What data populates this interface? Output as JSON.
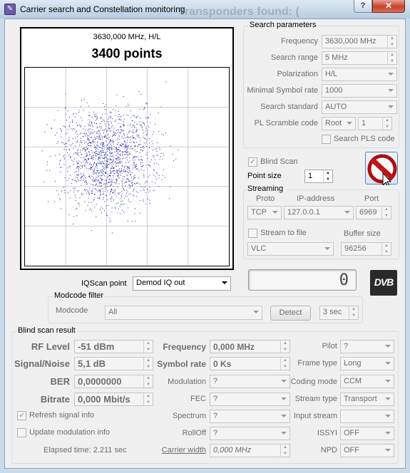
{
  "window": {
    "title": "Carrier search and Constellation monitoring",
    "background_title": "Transponders found: (",
    "help": "?",
    "close": "✕"
  },
  "plot": {
    "frequency_line": "3630,000 MHz, H/L",
    "points_line": "3400 points",
    "dot_color": "#1a1aa8"
  },
  "search": {
    "title": "Search parameters",
    "frequency_label": "Frequency",
    "frequency_value": "3630,000 MHz",
    "range_label": "Search range",
    "range_value": "5 MHz",
    "polarization_label": "Polarization",
    "polarization_value": "H/L",
    "symbolrate_label": "Minimal Symbol rate",
    "symbolrate_value": "1000",
    "standard_label": "Search standard",
    "standard_value": "AUTO",
    "pls_label": "PL Scramble code",
    "pls_mode": "Root",
    "pls_value": "1",
    "search_pls_label": "Search PLS code"
  },
  "blind_scan_label": "Blind Scan",
  "point_size_label": "Point size",
  "point_size_value": "1",
  "streaming": {
    "title": "Streaming",
    "proto_label": "Proto",
    "ip_label": "IP-address",
    "port_label": "Port",
    "proto_value": "TCP",
    "ip_value": "127.0.0.1",
    "port_value": "6969",
    "stream_file_label": "Stream to file",
    "buffer_label": "Buffer size",
    "player_value": "VLC",
    "buffer_value": "96256"
  },
  "iqscan": {
    "label": "IQScan point",
    "value": "Demod IQ out"
  },
  "counter_value": "0",
  "dvb_logo": "DVB",
  "modcode": {
    "title": "Modcode filter",
    "label": "Modcode",
    "value": "All",
    "detect_button": "Detect",
    "interval_value": "3 sec"
  },
  "result": {
    "title": "Blind scan result",
    "rf_level_label": "RF Level",
    "rf_level_value": "-51 dBm",
    "snr_label": "Signal/Noise",
    "snr_value": "5,1 dB",
    "ber_label": "BER",
    "ber_value": "0,0000000",
    "bitrate_label": "Bitrate",
    "bitrate_value": "0,000 Mbit/s",
    "frequency_label": "Frequency",
    "frequency_value": "0,000 MHz",
    "symbol_rate_label": "Symbol rate",
    "symbol_rate_value": "0 Ks",
    "modulation_label": "Modulation",
    "modulation_value": "?",
    "fec_label": "FEC",
    "fec_value": "?",
    "spectrum_label": "Spectrum",
    "spectrum_value": "?",
    "rolloff_label": "RollOff",
    "rolloff_value": "?",
    "carrier_width_label": "Carrier width",
    "carrier_width_value": "0,000 MHz",
    "pilot_label": "Pilot",
    "pilot_value": "?",
    "frame_type_label": "Frame type",
    "frame_type_value": "Long",
    "coding_mode_label": "Coding mode",
    "coding_mode_value": "CCM",
    "stream_type_label": "Stream type",
    "stream_type_value": "Transport",
    "input_stream_label": "Input stream",
    "input_stream_value": "",
    "issyi_label": "ISSYI",
    "issyi_value": "OFF",
    "npd_label": "NPD",
    "npd_value": "OFF",
    "refresh_label": "Refresh signal info",
    "update_mod_label": "Update modulation info",
    "elapsed_label": "Elapsed time: 2.211 sec"
  }
}
